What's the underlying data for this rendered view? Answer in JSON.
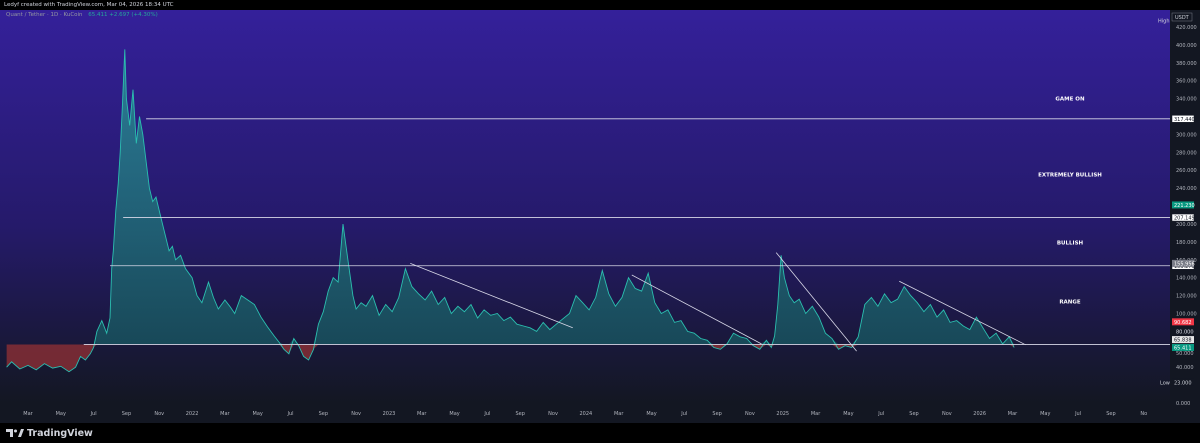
{
  "header": {
    "watermark": "Ledyf created with TradingView.com, Mar 04, 2026 18:34 UTC"
  },
  "legend": {
    "symbol": "Quant / Tether · 1D · KuCoin",
    "change": "65.411 +2.697 (+4.30%)"
  },
  "brand": {
    "name": "TradingView"
  },
  "colors": {
    "bg_top": "#34209a",
    "bg_bottom": "#131722",
    "line": "#2bbfb0",
    "up_fill": "#1f6f75",
    "down_fill": "#8c2f35",
    "down_line": "#e0464c",
    "level_line": "#d8d8e8",
    "trend_line": "#d8d8e8"
  },
  "chart_data": {
    "type": "area",
    "currency_label": "USDT",
    "high_label": "High",
    "low_label": "Low",
    "ylim": [
      0,
      432
    ],
    "yticks": [
      0,
      20,
      40,
      60,
      80,
      100,
      120,
      140,
      160,
      180,
      200,
      220,
      240,
      260,
      280,
      300,
      320,
      340,
      360,
      380,
      400,
      420
    ],
    "ytick_labels": [
      "0.000",
      "",
      "40.000",
      "60.000",
      "80.000",
      "100.000",
      "120.000",
      "140.000",
      "160.000",
      "180.000",
      "200.000",
      "",
      "240.000",
      "260.000",
      "280.000",
      "300.000",
      "",
      "340.000",
      "360.000",
      "380.000",
      "400.000",
      "420.000"
    ],
    "xticks": [
      {
        "t": 2.0,
        "label": "Mar"
      },
      {
        "t": 4.0,
        "label": "May"
      },
      {
        "t": 6.0,
        "label": "Jul"
      },
      {
        "t": 8.0,
        "label": "Sep"
      },
      {
        "t": 10.0,
        "label": "Nov"
      },
      {
        "t": 12.0,
        "label": "2022"
      },
      {
        "t": 14.0,
        "label": "Mar"
      },
      {
        "t": 16.0,
        "label": "May"
      },
      {
        "t": 18.0,
        "label": "Jul"
      },
      {
        "t": 20.0,
        "label": "Sep"
      },
      {
        "t": 22.0,
        "label": "Nov"
      },
      {
        "t": 24.0,
        "label": "2023"
      },
      {
        "t": 26.0,
        "label": "Mar"
      },
      {
        "t": 28.0,
        "label": "May"
      },
      {
        "t": 30.0,
        "label": "Jul"
      },
      {
        "t": 32.0,
        "label": "Sep"
      },
      {
        "t": 34.0,
        "label": "Nov"
      },
      {
        "t": 36.0,
        "label": "2024"
      },
      {
        "t": 38.0,
        "label": "Mar"
      },
      {
        "t": 40.0,
        "label": "May"
      },
      {
        "t": 42.0,
        "label": "Jul"
      },
      {
        "t": 44.0,
        "label": "Sep"
      },
      {
        "t": 46.0,
        "label": "Nov"
      },
      {
        "t": 48.0,
        "label": "2025"
      },
      {
        "t": 50.0,
        "label": "Mar"
      },
      {
        "t": 52.0,
        "label": "May"
      },
      {
        "t": 54.0,
        "label": "Jul"
      },
      {
        "t": 56.0,
        "label": "Sep"
      },
      {
        "t": 58.0,
        "label": "Nov"
      },
      {
        "t": 60.0,
        "label": "2026"
      },
      {
        "t": 62.0,
        "label": "Mar"
      },
      {
        "t": 64.0,
        "label": "May"
      },
      {
        "t": 66.0,
        "label": "Jul"
      },
      {
        "t": 68.0,
        "label": "Sep"
      },
      {
        "t": 70.0,
        "label": "No"
      }
    ],
    "xlim": [
      0.6,
      71.6
    ],
    "baseline": 65.411,
    "series": [
      {
        "t": [
          0.7,
          1.0,
          1.5,
          2.0,
          2.5,
          3.0,
          3.5,
          4.0,
          4.5,
          4.9,
          5.2,
          5.5,
          5.8,
          6.0,
          6.2,
          6.5,
          6.8,
          7.0,
          7.1,
          7.2,
          7.35,
          7.5,
          7.62,
          7.75,
          7.9,
          8.0,
          8.2,
          8.4,
          8.6,
          8.8,
          9.0,
          9.2,
          9.4,
          9.6,
          9.8,
          10.0,
          10.2,
          10.4,
          10.6,
          10.8,
          11.0,
          11.3,
          11.6,
          12.0,
          12.3,
          12.6,
          13.0,
          13.3,
          13.6,
          14.0,
          14.3,
          14.6,
          15.0,
          15.4,
          15.8,
          16.2,
          16.6,
          17.0,
          17.3,
          17.6,
          17.9,
          18.2,
          18.5,
          18.8,
          19.1,
          19.4,
          19.7,
          20.0,
          20.3,
          20.6,
          20.9,
          21.2,
          21.5,
          21.8,
          22.0,
          22.3,
          22.6,
          23.0,
          23.4,
          23.8,
          24.2,
          24.6,
          25.0,
          25.4,
          25.8,
          26.2,
          26.6,
          27.0,
          27.4,
          27.8,
          28.2,
          28.6,
          29.0,
          29.4,
          29.8,
          30.2,
          30.6,
          31.0,
          31.4,
          31.8,
          32.2,
          32.6,
          33.0,
          33.4,
          33.8,
          34.2,
          34.6,
          35.0,
          35.4,
          35.8,
          36.2,
          36.6,
          37.0,
          37.4,
          37.8,
          38.2,
          38.6,
          39.0,
          39.4,
          39.8,
          40.2,
          40.6,
          41.0,
          41.4,
          41.8,
          42.2,
          42.6,
          43.0,
          43.4,
          43.8,
          44.2,
          44.6,
          45.0,
          45.4,
          45.8,
          46.2,
          46.6,
          47.0,
          47.3,
          47.5,
          47.7,
          47.9,
          48.1,
          48.4,
          48.7,
          49.0,
          49.4,
          49.8,
          50.2,
          50.6,
          51.0,
          51.4,
          51.8,
          52.2,
          52.6,
          53.0,
          53.4,
          53.8,
          54.2,
          54.6,
          55.0,
          55.4,
          55.8,
          56.2,
          56.6,
          57.0,
          57.4,
          57.8,
          58.2,
          58.6,
          59.0,
          59.4,
          59.8,
          60.2,
          60.6,
          61.0,
          61.4,
          61.8,
          62.1
        ],
        "v": [
          40,
          46,
          38,
          42,
          37,
          44,
          39,
          41,
          35,
          40,
          52,
          48,
          55,
          62,
          80,
          92,
          78,
          95,
          150,
          170,
          215,
          245,
          280,
          330,
          395,
          340,
          310,
          350,
          290,
          320,
          300,
          270,
          240,
          225,
          230,
          215,
          200,
          185,
          170,
          175,
          160,
          165,
          150,
          140,
          120,
          112,
          135,
          118,
          105,
          115,
          108,
          100,
          120,
          115,
          110,
          96,
          85,
          75,
          68,
          60,
          55,
          72,
          64,
          52,
          48,
          60,
          88,
          102,
          125,
          140,
          135,
          200,
          160,
          120,
          105,
          112,
          108,
          120,
          98,
          110,
          102,
          118,
          150,
          130,
          122,
          115,
          125,
          110,
          118,
          100,
          108,
          102,
          110,
          95,
          104,
          98,
          100,
          92,
          96,
          88,
          86,
          84,
          80,
          90,
          82,
          88,
          94,
          100,
          120,
          112,
          104,
          118,
          148,
          122,
          108,
          118,
          140,
          128,
          125,
          145,
          112,
          100,
          104,
          90,
          92,
          80,
          78,
          72,
          70,
          62,
          60,
          66,
          78,
          74,
          72,
          64,
          60,
          70,
          62,
          75,
          110,
          165,
          140,
          120,
          112,
          116,
          100,
          108,
          96,
          78,
          72,
          60,
          64,
          62,
          74,
          110,
          118,
          108,
          122,
          112,
          116,
          130,
          120,
          112,
          102,
          110,
          96,
          104,
          90,
          92,
          86,
          82,
          96,
          84,
          72,
          78,
          66,
          74,
          62
        ]
      }
    ],
    "levels": [
      {
        "value": 317.44,
        "label": "317.440",
        "from_t": 9.2,
        "tag": "white"
      },
      {
        "value": 207.149,
        "label": "207.149",
        "from_t": 7.8,
        "tag": "white"
      },
      {
        "value": 153.273,
        "label": "153.273",
        "from_t": 7.0,
        "tag": "white"
      },
      {
        "value": 65.411,
        "label": "",
        "from_t": 5.4,
        "tag": "none"
      }
    ],
    "price_tags": [
      {
        "value": 221.23,
        "label": "221.230",
        "color": "#089981",
        "text": "#ffffff"
      },
      {
        "value": 155.956,
        "label": "155.956",
        "color": "#787b86",
        "text": "#ffffff"
      },
      {
        "value": 90.682,
        "label": "90.682",
        "color": "#f23645",
        "text": "#ffffff"
      },
      {
        "value": 70.838,
        "label": "65.838",
        "color": "#e6e6e6",
        "text": "#131722"
      },
      {
        "value": 62.0,
        "label": "65.411",
        "color": "#089981",
        "text": "#ffffff"
      },
      {
        "value": 23.0,
        "label": "23.000",
        "color": "#131722",
        "text": "#d1d4dc"
      }
    ],
    "small_labels": [
      {
        "value": 80,
        "label": "80.000"
      },
      {
        "value": 56,
        "label": "50.000"
      }
    ],
    "zones": [
      {
        "value": 338,
        "label": "GAME ON"
      },
      {
        "value": 253,
        "label": "EXTREMELY BULLISH"
      },
      {
        "value": 177,
        "label": "BULLISH"
      },
      {
        "value": 111,
        "label": "RANGE"
      }
    ],
    "trendlines": [
      {
        "t1": 25.3,
        "v1": 156,
        "t2": 35.2,
        "v2": 84
      },
      {
        "t1": 38.8,
        "v1": 143,
        "t2": 46.7,
        "v2": 66
      },
      {
        "t1": 47.6,
        "v1": 168,
        "t2": 52.5,
        "v2": 58
      },
      {
        "t1": 55.1,
        "v1": 136,
        "t2": 62.8,
        "v2": 65
      }
    ]
  }
}
